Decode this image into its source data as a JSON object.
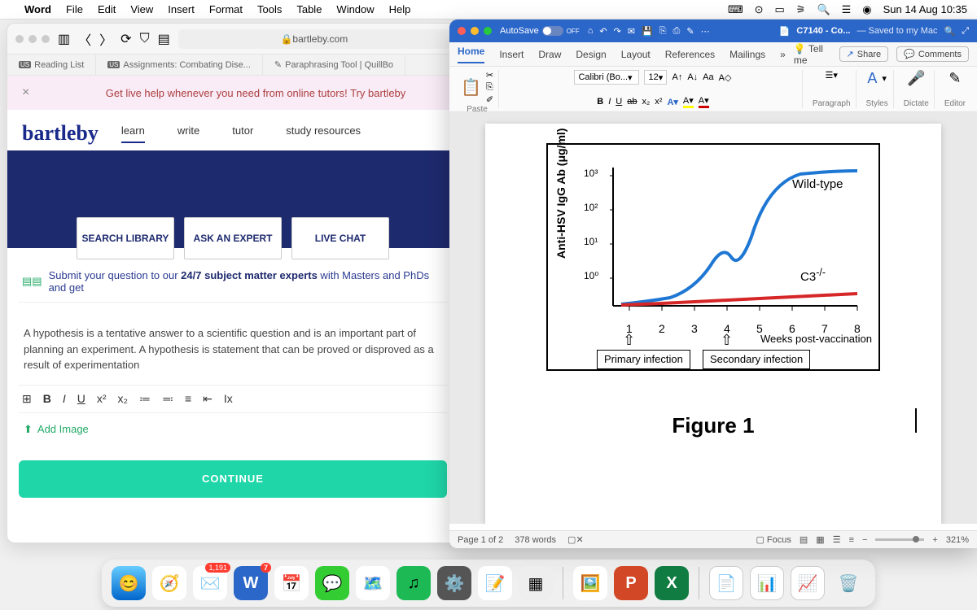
{
  "menubar": {
    "app": "Word",
    "items": [
      "File",
      "Edit",
      "View",
      "Insert",
      "Format",
      "Tools",
      "Table",
      "Window",
      "Help"
    ],
    "clock": "Sun 14 Aug  10:35"
  },
  "safari": {
    "url": "bartleby.com",
    "tabs": [
      "Reading List",
      "Assignments: Combating Dise...",
      "Paraphrasing Tool | QuillBo"
    ],
    "banner_close": "×",
    "banner_text": "Get live help whenever you need from online tutors!  Try bartleby",
    "brand": "bartleby",
    "nav": [
      "learn",
      "write",
      "tutor",
      "study resources"
    ],
    "hero_cards": [
      "SEARCH LIBRARY",
      "ASK AN EXPERT",
      "LIVE CHAT"
    ],
    "subhead_a": "Submit your question to our ",
    "subhead_b": "24/7 subject matter experts",
    "subhead_c": " with Masters and PhDs and get",
    "editor_text": "A hypothesis is a tentative answer to a scientific question and is an important part of planning an experiment. A hypothesis is statement that can be proved or disproved as a result of experimentation",
    "toolbar": [
      "⊞",
      "B",
      "I",
      "U",
      "x²",
      "x₂",
      "≔",
      "≕",
      "≡",
      "⇤",
      "Ix"
    ],
    "add_image": "Add Image",
    "continue": "CONTINUE"
  },
  "word": {
    "autosave_label": "AutoSave",
    "autosave_state": "OFF",
    "doc_name": "C7140 - Co...",
    "save_state": "— Saved to my Mac",
    "tabs": [
      "Home",
      "Insert",
      "Draw",
      "Design",
      "Layout",
      "References",
      "Mailings"
    ],
    "tellme": "Tell me",
    "share": "Share",
    "comments": "Comments",
    "font_name": "Calibri (Bo...",
    "font_size": "12",
    "groups": {
      "paste": "Paste",
      "paragraph": "Paragraph",
      "styles": "Styles",
      "dictate": "Dictate",
      "editor": "Editor"
    },
    "fmt": {
      "bold": "B",
      "italic": "I",
      "under": "U",
      "strike": "ab",
      "sub": "x₂",
      "sup": "x²",
      "caseAa": "Aa",
      "bigA": "A",
      "highlight": "A",
      "fontcolor": "A"
    },
    "status": {
      "page": "Page 1 of 2",
      "words": "378 words",
      "focus": "Focus",
      "zoom": "321%"
    }
  },
  "figure": {
    "ylabel": "Anti-HSV IgG Ab (μg/ml)",
    "yticks": [
      "10³",
      "10²",
      "10¹",
      "10⁰"
    ],
    "xticks": [
      "1",
      "2",
      "3",
      "4",
      "5",
      "6",
      "7",
      "8"
    ],
    "xunit": "Weeks post-vaccination",
    "series1": "Wild-type",
    "series2": "C3",
    "primary": "Primary infection",
    "secondary": "Secondary infection",
    "caption": "Figure 1"
  },
  "chart_data": {
    "type": "line",
    "title": "Figure 1",
    "xlabel": "Weeks post-vaccination",
    "ylabel": "Anti-HSV IgG Ab (μg/ml)",
    "x": [
      1,
      2,
      3,
      4,
      5,
      6,
      7,
      8
    ],
    "yscale": "log",
    "ylim": [
      1,
      2000
    ],
    "series": [
      {
        "name": "Wild-type",
        "color": "#1f77d4",
        "values": [
          1,
          2,
          5,
          10,
          6,
          50,
          1200,
          1500
        ]
      },
      {
        "name": "C3",
        "color": "#d62728",
        "values": [
          1,
          1.2,
          1.4,
          1.6,
          1.8,
          2.0,
          2.2,
          2.4
        ]
      }
    ],
    "annotations": [
      {
        "x": 1,
        "text": "Primary infection"
      },
      {
        "x": 4,
        "text": "Secondary infection"
      }
    ]
  },
  "dock": {
    "apps": [
      "finder",
      "safari",
      "mail",
      "word",
      "calendar",
      "messages",
      "maps",
      "spotify",
      "settings",
      "notes",
      "launchpad"
    ],
    "mail_badge": "1,191",
    "word_badge": "7",
    "right": [
      "preview",
      "powerpoint",
      "excel",
      "pages",
      "doc1",
      "doc2",
      "trash"
    ]
  }
}
